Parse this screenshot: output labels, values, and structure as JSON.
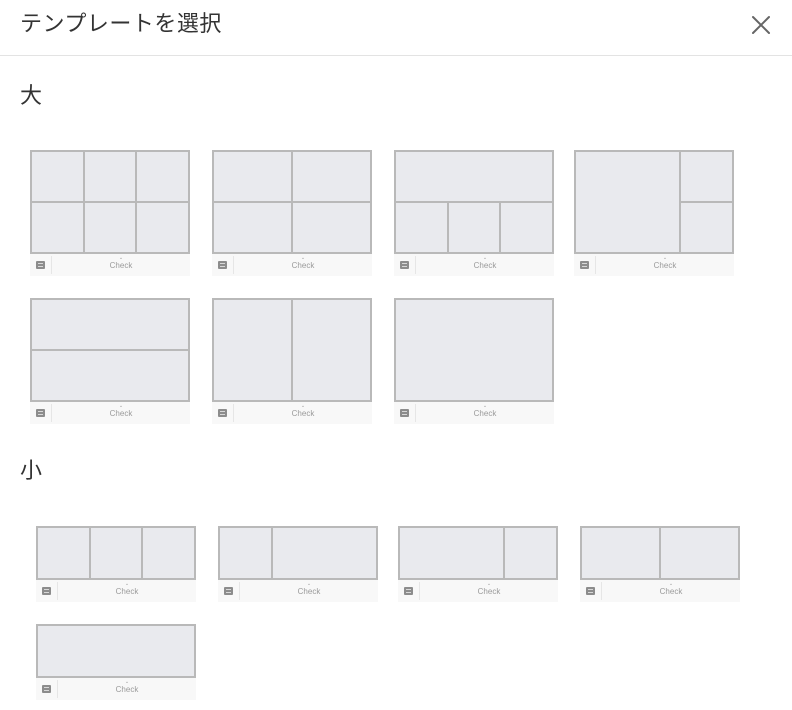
{
  "header": {
    "title": "テンプレートを選択",
    "close_icon": "close-icon"
  },
  "sections": {
    "large": {
      "title": "大"
    },
    "small": {
      "title": "小"
    }
  },
  "template_footer": {
    "label": "Check",
    "icon": "note-icon",
    "caret": "⌄"
  },
  "colors": {
    "cell_fill": "#e9eaee",
    "cell_border": "#b9b9b9",
    "divider": "#e3e3e3"
  }
}
